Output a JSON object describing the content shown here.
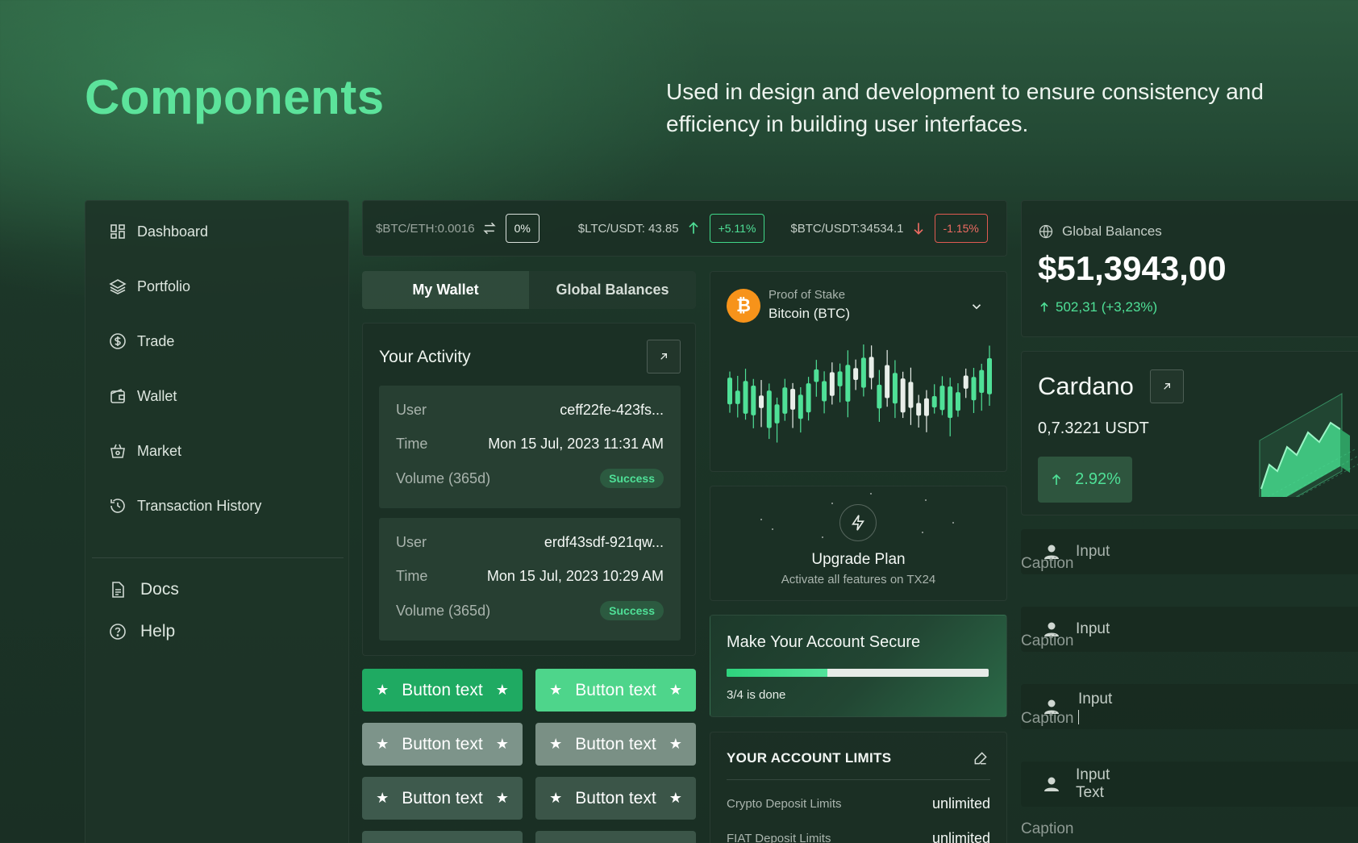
{
  "header": {
    "title": "Components",
    "description": "Used in design and development to ensure consistency and efficiency in building user interfaces."
  },
  "sidebar": {
    "items": [
      {
        "label": "Dashboard",
        "icon": "dashboard-icon"
      },
      {
        "label": "Portfolio",
        "icon": "layers-icon"
      },
      {
        "label": "Trade",
        "icon": "dollar-icon"
      },
      {
        "label": "Wallet",
        "icon": "wallet-icon"
      },
      {
        "label": "Market",
        "icon": "basket-icon"
      },
      {
        "label": "Transaction History",
        "icon": "history-icon"
      }
    ],
    "secondary": [
      {
        "label": "Docs",
        "icon": "document-icon"
      },
      {
        "label": "Help",
        "icon": "help-icon"
      }
    ]
  },
  "ticker": {
    "pair1": {
      "label": "$BTC/ETH:0.0016",
      "badge": "0%"
    },
    "pair2": {
      "label": "$LTC/USDT: 43.85",
      "badge": "+5.11%"
    },
    "pair3": {
      "label": "$BTC/USDT:34534.1",
      "badge": "-1.15%"
    }
  },
  "wallet_tabs": {
    "active": "My Wallet",
    "inactive": "Global Balances"
  },
  "activity": {
    "title": "Your Activity",
    "rows": [
      {
        "user_key": "User",
        "user": "ceff22fe-423fs...",
        "time_key": "Time",
        "time": "Mon 15 Jul, 2023 11:31 AM",
        "volume_key": "Volume (365d)",
        "status": "Success"
      },
      {
        "user_key": "User",
        "user": "erdf43sdf-921qw...",
        "time_key": "Time",
        "time": "Mon 15 Jul, 2023 10:29 AM",
        "volume_key": "Volume (365d)",
        "status": "Success"
      }
    ]
  },
  "buttons": {
    "label": "Button text"
  },
  "proof_of_stake": {
    "subtitle": "Proof of Stake",
    "coin": "Bitcoin (BTC)",
    "coin_symbol": "₿"
  },
  "upgrade": {
    "title": "Upgrade Plan",
    "subtitle": "Activate all features on TX24"
  },
  "secure": {
    "title": "Make Your Account Secure",
    "progress": 0.385,
    "caption": "3/4 is done"
  },
  "limits": {
    "title": "YOUR ACCOUNT LIMITS",
    "rows": [
      {
        "label": "Crypto Deposit Limits",
        "value": "unlimited"
      },
      {
        "label": "FIAT Deposit Limits",
        "value": "unlimited"
      }
    ]
  },
  "global_balances": {
    "label": "Global Balances",
    "amount": "$51,3943,00",
    "change": "502,31 (+3,23%)"
  },
  "cardano": {
    "name": "Cardano",
    "price": "0,7.3221 USDT",
    "change": "2.92%"
  },
  "inputs": {
    "placeholder": "Input",
    "caption": "Caption",
    "typed_value": "Input",
    "multiline_value_line1": "Input",
    "multiline_value_line2": "Text"
  },
  "colors": {
    "accent": "#5ce39b",
    "primary_button": "#1faa62",
    "success": "#4fe097",
    "danger": "#ee6b62",
    "bitcoin": "#f7931a"
  }
}
